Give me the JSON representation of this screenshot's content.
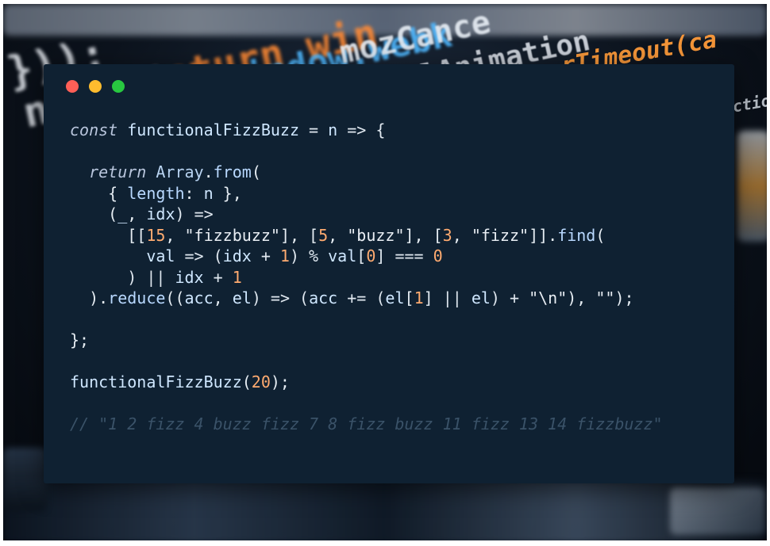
{
  "background_code": {
    "line1": "}));",
    "line2": "nceUni",
    "line3": "return win",
    "line4": "indow.webk",
    "line5": "mozCance",
    "line6": "celAnimation",
    "line7": "rTimeout(ca",
    "line8": "nction("
  },
  "window_controls": {
    "close_color": "#ff5f57",
    "minimize_color": "#febc2e",
    "maximize_color": "#28c840"
  },
  "code": {
    "lines": [
      [
        {
          "t": "const",
          "c": "kw"
        },
        {
          "t": " ",
          "c": "pn"
        },
        {
          "t": "functionalFizzBuzz",
          "c": "id"
        },
        {
          "t": " = ",
          "c": "op"
        },
        {
          "t": "n",
          "c": "id"
        },
        {
          "t": " => {",
          "c": "op"
        }
      ],
      [],
      [
        {
          "t": "  ",
          "c": "pn"
        },
        {
          "t": "return",
          "c": "kw"
        },
        {
          "t": " ",
          "c": "pn"
        },
        {
          "t": "Array",
          "c": "ty"
        },
        {
          "t": ".",
          "c": "pn"
        },
        {
          "t": "from",
          "c": "pr"
        },
        {
          "t": "(",
          "c": "pn"
        }
      ],
      [
        {
          "t": "    { ",
          "c": "pn"
        },
        {
          "t": "length",
          "c": "pr"
        },
        {
          "t": ": ",
          "c": "pn"
        },
        {
          "t": "n",
          "c": "id"
        },
        {
          "t": " },",
          "c": "pn"
        }
      ],
      [
        {
          "t": "    (",
          "c": "pn"
        },
        {
          "t": "_",
          "c": "id"
        },
        {
          "t": ", ",
          "c": "pn"
        },
        {
          "t": "idx",
          "c": "id"
        },
        {
          "t": ") =>",
          "c": "op"
        }
      ],
      [
        {
          "t": "      [[",
          "c": "pn"
        },
        {
          "t": "15",
          "c": "nm"
        },
        {
          "t": ", ",
          "c": "pn"
        },
        {
          "t": "\"fizzbuzz\"",
          "c": "st"
        },
        {
          "t": "], [",
          "c": "pn"
        },
        {
          "t": "5",
          "c": "nm"
        },
        {
          "t": ", ",
          "c": "pn"
        },
        {
          "t": "\"buzz\"",
          "c": "st"
        },
        {
          "t": "], [",
          "c": "pn"
        },
        {
          "t": "3",
          "c": "nm"
        },
        {
          "t": ", ",
          "c": "pn"
        },
        {
          "t": "\"fizz\"",
          "c": "st"
        },
        {
          "t": "]].",
          "c": "pn"
        },
        {
          "t": "find",
          "c": "pr"
        },
        {
          "t": "(",
          "c": "pn"
        }
      ],
      [
        {
          "t": "        ",
          "c": "pn"
        },
        {
          "t": "val",
          "c": "id"
        },
        {
          "t": " => (",
          "c": "op"
        },
        {
          "t": "idx",
          "c": "id"
        },
        {
          "t": " + ",
          "c": "op"
        },
        {
          "t": "1",
          "c": "nm"
        },
        {
          "t": ") % ",
          "c": "op"
        },
        {
          "t": "val",
          "c": "id"
        },
        {
          "t": "[",
          "c": "pn"
        },
        {
          "t": "0",
          "c": "nm"
        },
        {
          "t": "] === ",
          "c": "op"
        },
        {
          "t": "0",
          "c": "nm"
        }
      ],
      [
        {
          "t": "      ) || ",
          "c": "op"
        },
        {
          "t": "idx",
          "c": "id"
        },
        {
          "t": " + ",
          "c": "op"
        },
        {
          "t": "1",
          "c": "nm"
        }
      ],
      [
        {
          "t": "  ).",
          "c": "pn"
        },
        {
          "t": "reduce",
          "c": "pr"
        },
        {
          "t": "((",
          "c": "pn"
        },
        {
          "t": "acc",
          "c": "id"
        },
        {
          "t": ", ",
          "c": "pn"
        },
        {
          "t": "el",
          "c": "id"
        },
        {
          "t": ") => (",
          "c": "op"
        },
        {
          "t": "acc",
          "c": "id"
        },
        {
          "t": " += (",
          "c": "op"
        },
        {
          "t": "el",
          "c": "id"
        },
        {
          "t": "[",
          "c": "pn"
        },
        {
          "t": "1",
          "c": "nm"
        },
        {
          "t": "] || ",
          "c": "op"
        },
        {
          "t": "el",
          "c": "id"
        },
        {
          "t": ") + ",
          "c": "op"
        },
        {
          "t": "\"\\n\"",
          "c": "st"
        },
        {
          "t": "), ",
          "c": "pn"
        },
        {
          "t": "\"\"",
          "c": "st"
        },
        {
          "t": ");",
          "c": "pn"
        }
      ],
      [],
      [
        {
          "t": "};",
          "c": "pn"
        }
      ],
      [],
      [
        {
          "t": "functionalFizzBuzz",
          "c": "id"
        },
        {
          "t": "(",
          "c": "pn"
        },
        {
          "t": "20",
          "c": "nm"
        },
        {
          "t": ");",
          "c": "pn"
        }
      ],
      [],
      [
        {
          "t": "// \"1 2 fizz 4 buzz fizz 7 8 fizz buzz 11 fizz 13 14 fizzbuzz\"",
          "c": "cm"
        }
      ]
    ]
  }
}
